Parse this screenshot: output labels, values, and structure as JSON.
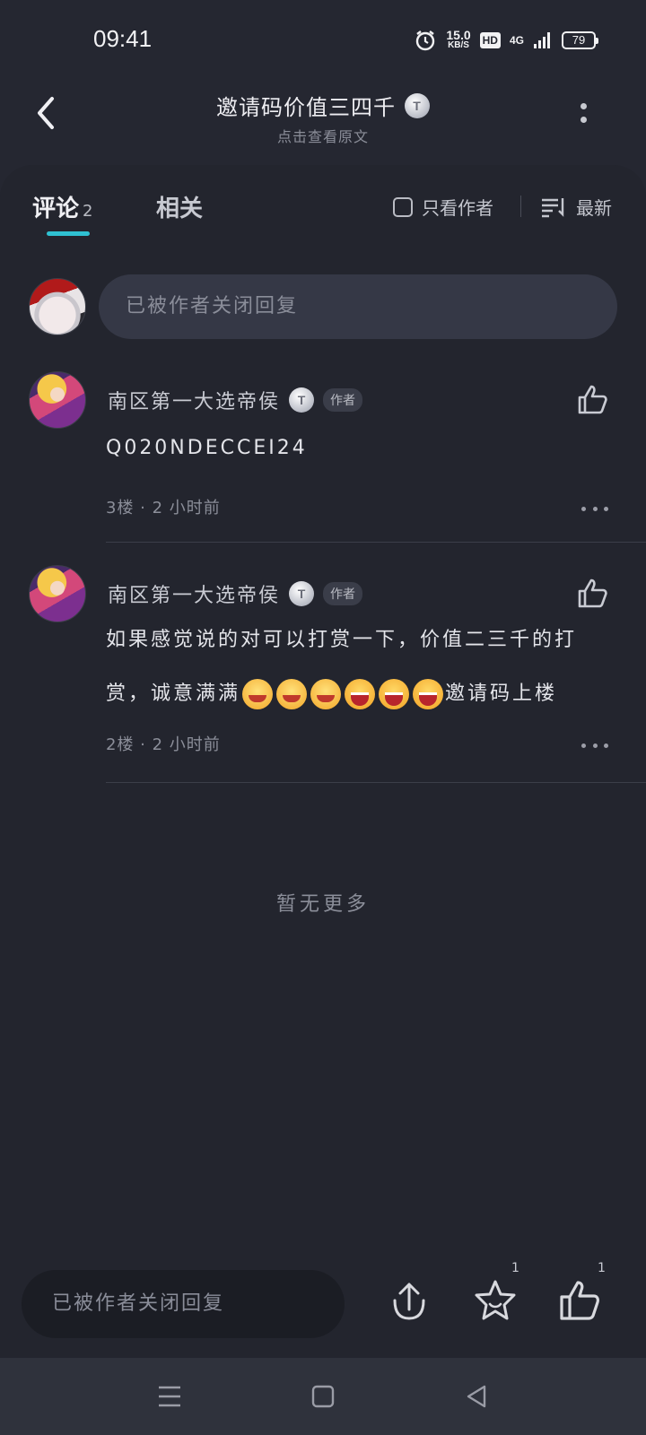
{
  "status_bar": {
    "time": "09:41",
    "speed_value": "15.0",
    "speed_unit": "KB/S",
    "hd_label": "HD",
    "network_label": "4G",
    "battery": "79",
    "icons": [
      "alarm-icon",
      "signal-icon"
    ]
  },
  "header": {
    "title": "邀请码价值三四千",
    "level_badge": "T",
    "subtitle": "点击查看原文"
  },
  "tabs": {
    "comments_label": "评论",
    "comments_count": "2",
    "related_label": "相关",
    "author_only_label": "只看作者",
    "sort_label": "最新"
  },
  "reply_box": {
    "placeholder": "已被作者关闭回复"
  },
  "comments": [
    {
      "author": "南区第一大选帝侯",
      "level_badge": "T",
      "author_tag": "作者",
      "text": "Q020NDECCEI24",
      "meta": "3楼 · 2 小时前"
    },
    {
      "author": "南区第一大选帝侯",
      "level_badge": "T",
      "author_tag": "作者",
      "text_before": "如果感觉说的对可以打赏一下，价值二三千的打赏，诚意满满",
      "text_after": "邀请码上楼",
      "emojis": [
        "blush",
        "blush",
        "blush",
        "laugh",
        "laugh",
        "laugh"
      ],
      "meta": "2楼 · 2 小时前"
    }
  ],
  "no_more": "暂无更多",
  "bottom_bar": {
    "placeholder": "已被作者关闭回复",
    "favorite_count": "1",
    "like_count": "1"
  },
  "colors": {
    "background": "#252731",
    "accent": "#2fc1d2",
    "input_bg": "#353846"
  }
}
